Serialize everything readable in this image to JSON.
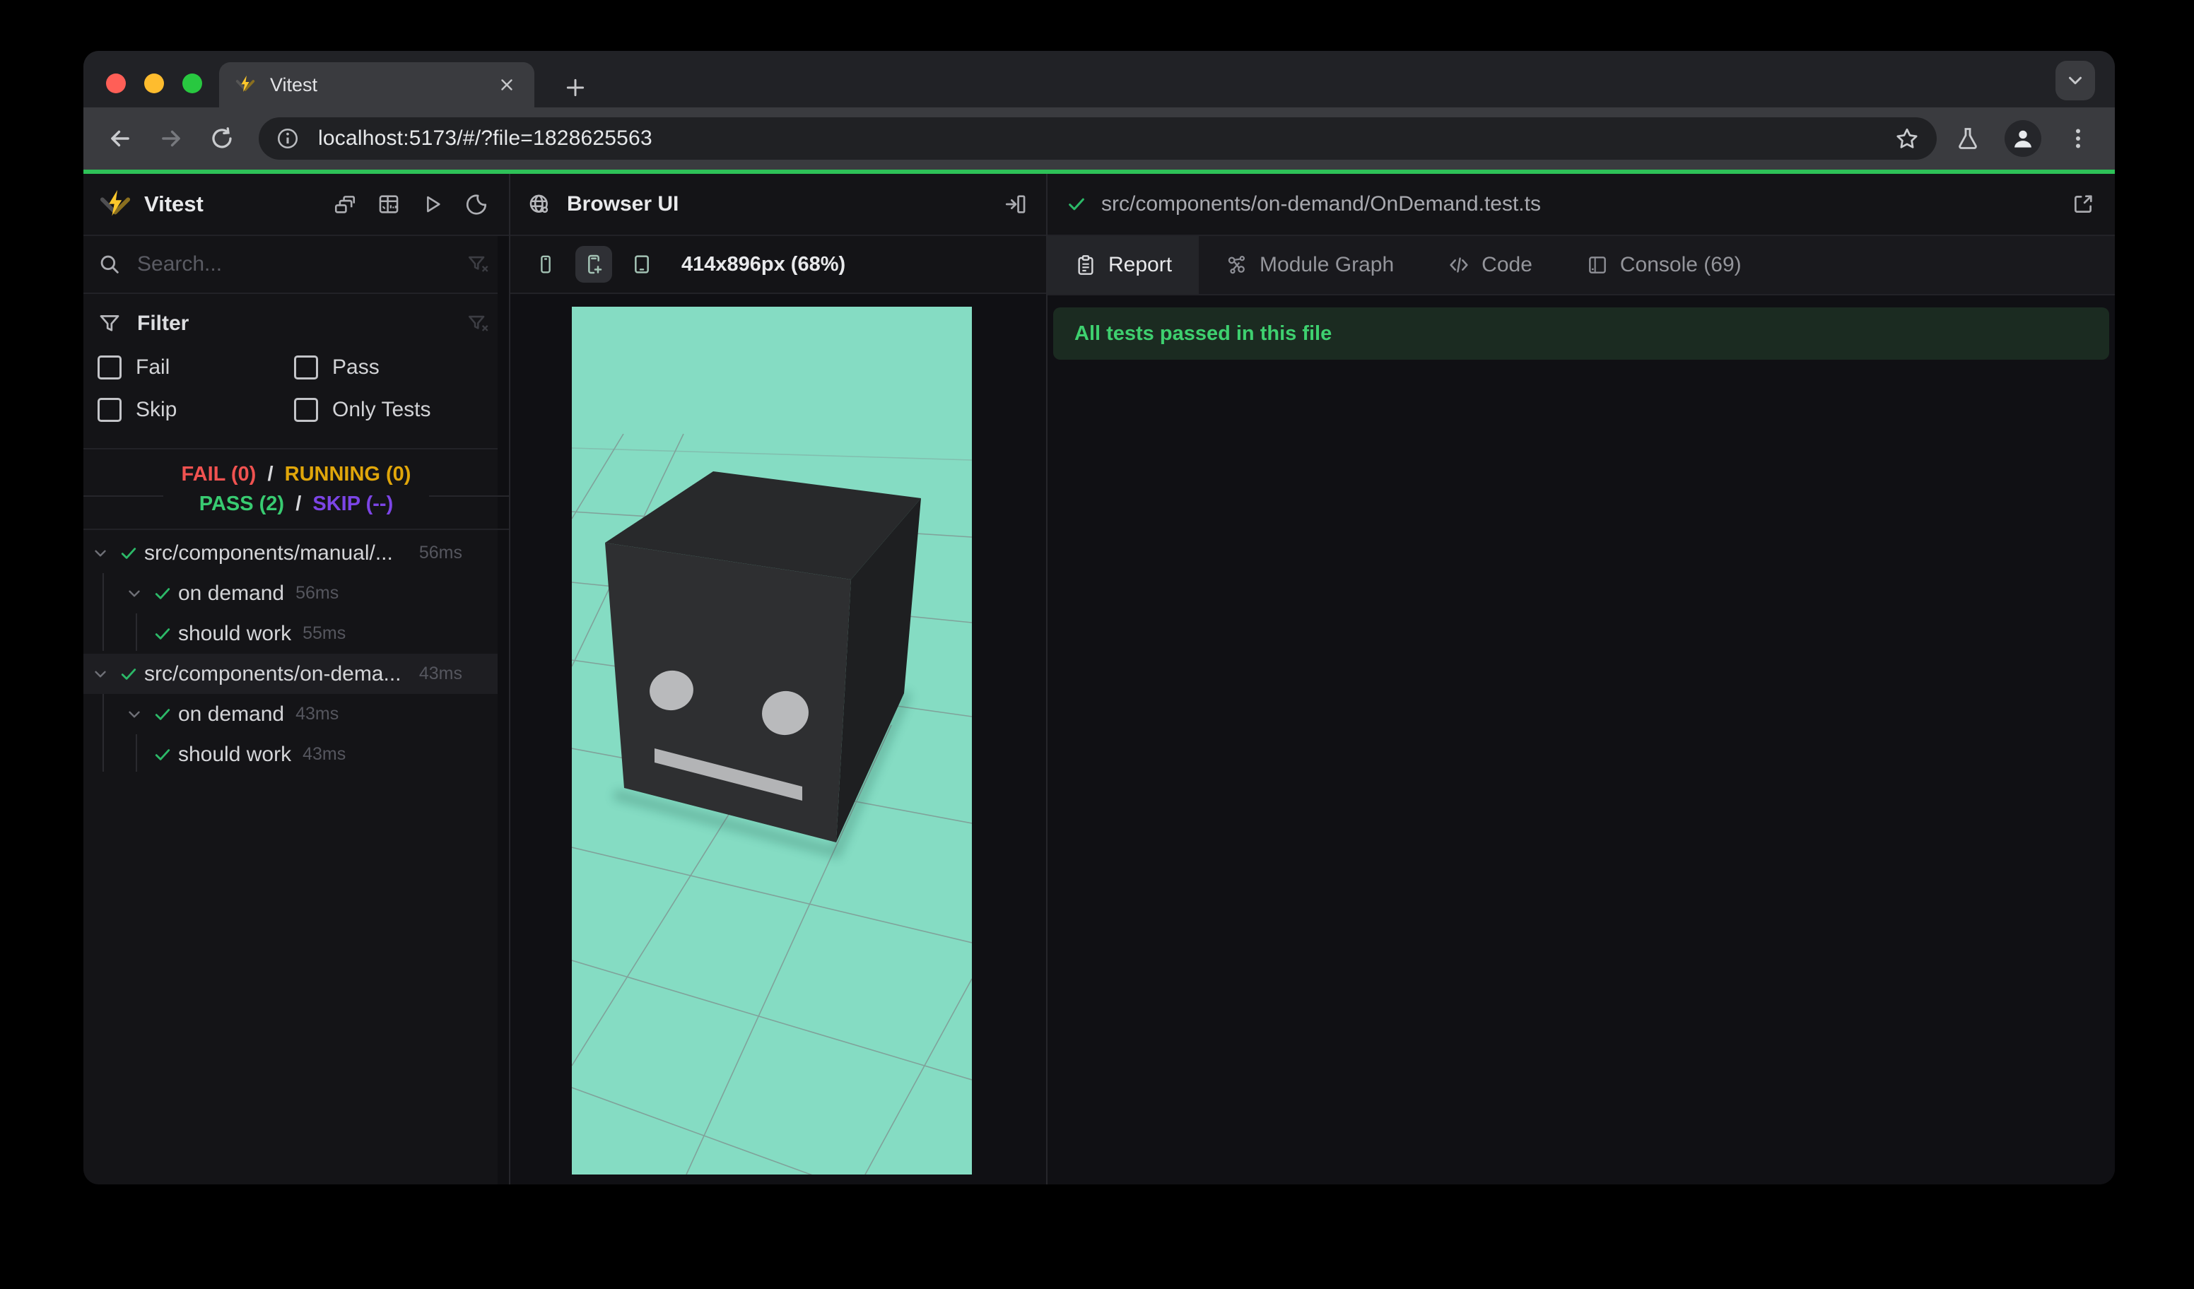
{
  "chrome": {
    "tab_title": "Vitest",
    "url": "localhost:5173/#/?file=1828625563"
  },
  "sidebar": {
    "app_title": "Vitest",
    "search_placeholder": "Search...",
    "filter": {
      "title": "Filter",
      "options": [
        "Fail",
        "Pass",
        "Skip",
        "Only Tests"
      ]
    },
    "status": {
      "fail": "FAIL (0)",
      "running": "RUNNING (0)",
      "pass": "PASS (2)",
      "skip": "SKIP (--)",
      "sep": "/"
    },
    "tree": [
      {
        "label": "src/components/manual/...",
        "duration": "56ms",
        "type": "file"
      },
      {
        "label": "on demand",
        "duration": "56ms",
        "type": "suite"
      },
      {
        "label": "should work",
        "duration": "55ms",
        "type": "test"
      },
      {
        "label": "src/components/on-dema...",
        "duration": "43ms",
        "type": "file",
        "selected": true
      },
      {
        "label": "on demand",
        "duration": "43ms",
        "type": "suite"
      },
      {
        "label": "should work",
        "duration": "43ms",
        "type": "test"
      }
    ]
  },
  "middle": {
    "title": "Browser UI",
    "size_label": "414x896px (68%)"
  },
  "right": {
    "file_path": "src/components/on-demand/OnDemand.test.ts",
    "tabs": [
      {
        "label": "Report",
        "active": true
      },
      {
        "label": "Module Graph"
      },
      {
        "label": "Code"
      },
      {
        "label": "Console (69)"
      }
    ],
    "banner": "All tests passed in this file"
  },
  "colors": {
    "accent_green": "#2ec158",
    "pass_green": "#38cb71",
    "fail_red": "#f05250",
    "running_amber": "#e0a60a",
    "skip_purple": "#7c45e6",
    "viewport_teal": "#85dcc3",
    "banner_bg": "#1b2b21",
    "logo_yellow": "#fcc72b"
  }
}
